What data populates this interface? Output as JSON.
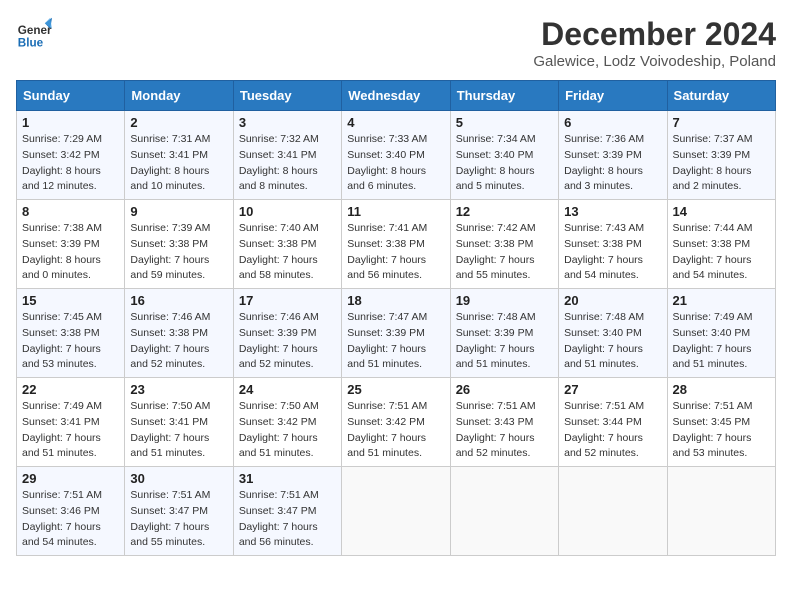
{
  "header": {
    "logo_line1": "General",
    "logo_line2": "Blue",
    "main_title": "December 2024",
    "subtitle": "Galewice, Lodz Voivodeship, Poland"
  },
  "calendar": {
    "days_of_week": [
      "Sunday",
      "Monday",
      "Tuesday",
      "Wednesday",
      "Thursday",
      "Friday",
      "Saturday"
    ],
    "weeks": [
      [
        {
          "day": "1",
          "sunrise": "Sunrise: 7:29 AM",
          "sunset": "Sunset: 3:42 PM",
          "daylight": "Daylight: 8 hours and 12 minutes."
        },
        {
          "day": "2",
          "sunrise": "Sunrise: 7:31 AM",
          "sunset": "Sunset: 3:41 PM",
          "daylight": "Daylight: 8 hours and 10 minutes."
        },
        {
          "day": "3",
          "sunrise": "Sunrise: 7:32 AM",
          "sunset": "Sunset: 3:41 PM",
          "daylight": "Daylight: 8 hours and 8 minutes."
        },
        {
          "day": "4",
          "sunrise": "Sunrise: 7:33 AM",
          "sunset": "Sunset: 3:40 PM",
          "daylight": "Daylight: 8 hours and 6 minutes."
        },
        {
          "day": "5",
          "sunrise": "Sunrise: 7:34 AM",
          "sunset": "Sunset: 3:40 PM",
          "daylight": "Daylight: 8 hours and 5 minutes."
        },
        {
          "day": "6",
          "sunrise": "Sunrise: 7:36 AM",
          "sunset": "Sunset: 3:39 PM",
          "daylight": "Daylight: 8 hours and 3 minutes."
        },
        {
          "day": "7",
          "sunrise": "Sunrise: 7:37 AM",
          "sunset": "Sunset: 3:39 PM",
          "daylight": "Daylight: 8 hours and 2 minutes."
        }
      ],
      [
        {
          "day": "8",
          "sunrise": "Sunrise: 7:38 AM",
          "sunset": "Sunset: 3:39 PM",
          "daylight": "Daylight: 8 hours and 0 minutes."
        },
        {
          "day": "9",
          "sunrise": "Sunrise: 7:39 AM",
          "sunset": "Sunset: 3:38 PM",
          "daylight": "Daylight: 7 hours and 59 minutes."
        },
        {
          "day": "10",
          "sunrise": "Sunrise: 7:40 AM",
          "sunset": "Sunset: 3:38 PM",
          "daylight": "Daylight: 7 hours and 58 minutes."
        },
        {
          "day": "11",
          "sunrise": "Sunrise: 7:41 AM",
          "sunset": "Sunset: 3:38 PM",
          "daylight": "Daylight: 7 hours and 56 minutes."
        },
        {
          "day": "12",
          "sunrise": "Sunrise: 7:42 AM",
          "sunset": "Sunset: 3:38 PM",
          "daylight": "Daylight: 7 hours and 55 minutes."
        },
        {
          "day": "13",
          "sunrise": "Sunrise: 7:43 AM",
          "sunset": "Sunset: 3:38 PM",
          "daylight": "Daylight: 7 hours and 54 minutes."
        },
        {
          "day": "14",
          "sunrise": "Sunrise: 7:44 AM",
          "sunset": "Sunset: 3:38 PM",
          "daylight": "Daylight: 7 hours and 54 minutes."
        }
      ],
      [
        {
          "day": "15",
          "sunrise": "Sunrise: 7:45 AM",
          "sunset": "Sunset: 3:38 PM",
          "daylight": "Daylight: 7 hours and 53 minutes."
        },
        {
          "day": "16",
          "sunrise": "Sunrise: 7:46 AM",
          "sunset": "Sunset: 3:38 PM",
          "daylight": "Daylight: 7 hours and 52 minutes."
        },
        {
          "day": "17",
          "sunrise": "Sunrise: 7:46 AM",
          "sunset": "Sunset: 3:39 PM",
          "daylight": "Daylight: 7 hours and 52 minutes."
        },
        {
          "day": "18",
          "sunrise": "Sunrise: 7:47 AM",
          "sunset": "Sunset: 3:39 PM",
          "daylight": "Daylight: 7 hours and 51 minutes."
        },
        {
          "day": "19",
          "sunrise": "Sunrise: 7:48 AM",
          "sunset": "Sunset: 3:39 PM",
          "daylight": "Daylight: 7 hours and 51 minutes."
        },
        {
          "day": "20",
          "sunrise": "Sunrise: 7:48 AM",
          "sunset": "Sunset: 3:40 PM",
          "daylight": "Daylight: 7 hours and 51 minutes."
        },
        {
          "day": "21",
          "sunrise": "Sunrise: 7:49 AM",
          "sunset": "Sunset: 3:40 PM",
          "daylight": "Daylight: 7 hours and 51 minutes."
        }
      ],
      [
        {
          "day": "22",
          "sunrise": "Sunrise: 7:49 AM",
          "sunset": "Sunset: 3:41 PM",
          "daylight": "Daylight: 7 hours and 51 minutes."
        },
        {
          "day": "23",
          "sunrise": "Sunrise: 7:50 AM",
          "sunset": "Sunset: 3:41 PM",
          "daylight": "Daylight: 7 hours and 51 minutes."
        },
        {
          "day": "24",
          "sunrise": "Sunrise: 7:50 AM",
          "sunset": "Sunset: 3:42 PM",
          "daylight": "Daylight: 7 hours and 51 minutes."
        },
        {
          "day": "25",
          "sunrise": "Sunrise: 7:51 AM",
          "sunset": "Sunset: 3:42 PM",
          "daylight": "Daylight: 7 hours and 51 minutes."
        },
        {
          "day": "26",
          "sunrise": "Sunrise: 7:51 AM",
          "sunset": "Sunset: 3:43 PM",
          "daylight": "Daylight: 7 hours and 52 minutes."
        },
        {
          "day": "27",
          "sunrise": "Sunrise: 7:51 AM",
          "sunset": "Sunset: 3:44 PM",
          "daylight": "Daylight: 7 hours and 52 minutes."
        },
        {
          "day": "28",
          "sunrise": "Sunrise: 7:51 AM",
          "sunset": "Sunset: 3:45 PM",
          "daylight": "Daylight: 7 hours and 53 minutes."
        }
      ],
      [
        {
          "day": "29",
          "sunrise": "Sunrise: 7:51 AM",
          "sunset": "Sunset: 3:46 PM",
          "daylight": "Daylight: 7 hours and 54 minutes."
        },
        {
          "day": "30",
          "sunrise": "Sunrise: 7:51 AM",
          "sunset": "Sunset: 3:47 PM",
          "daylight": "Daylight: 7 hours and 55 minutes."
        },
        {
          "day": "31",
          "sunrise": "Sunrise: 7:51 AM",
          "sunset": "Sunset: 3:47 PM",
          "daylight": "Daylight: 7 hours and 56 minutes."
        },
        null,
        null,
        null,
        null
      ]
    ]
  }
}
